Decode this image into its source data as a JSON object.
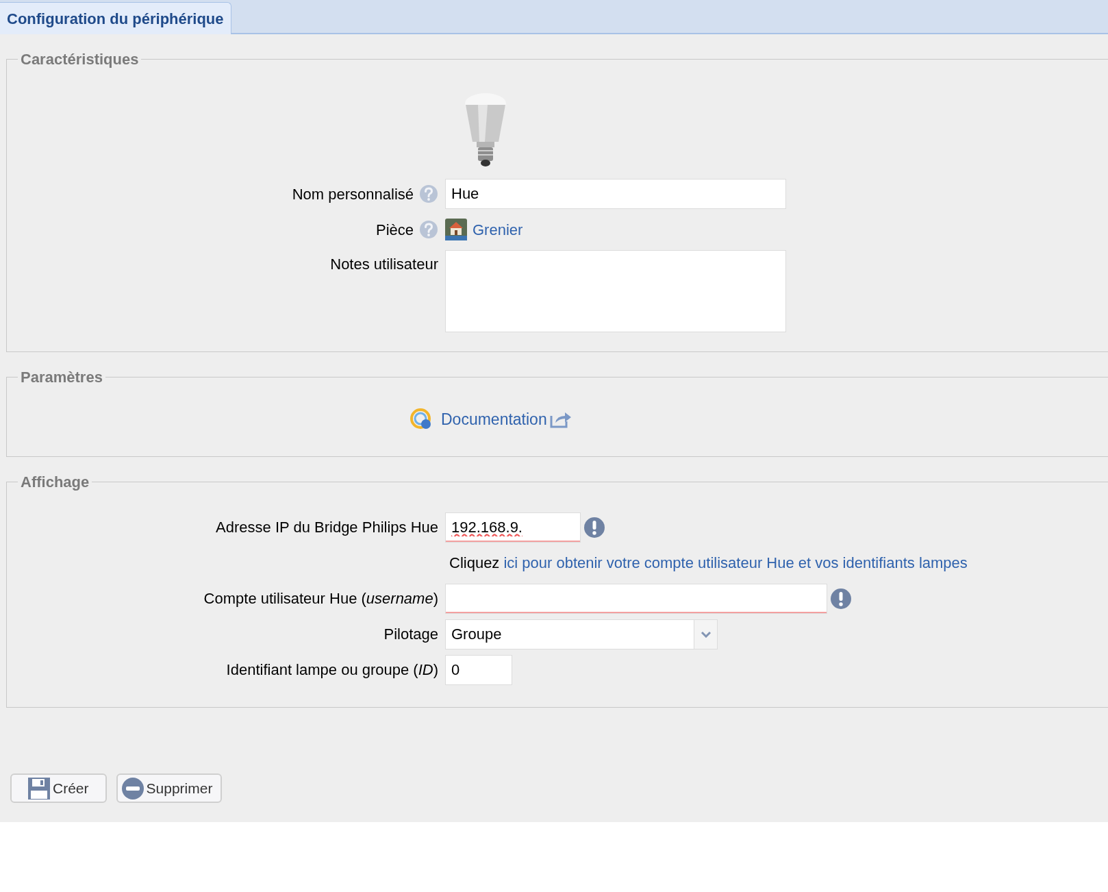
{
  "tab": {
    "label": "Configuration du périphérique",
    "selected": true
  },
  "sections": [
    {
      "legend": "Caractéristiques",
      "kind": "characteristics",
      "fields": [
        {
          "kind": "text",
          "label": "Nom personnalisé",
          "help": true,
          "value": "Hue",
          "warning": false
        },
        {
          "kind": "room",
          "label": "Pièce",
          "help": true,
          "value": "Grenier"
        },
        {
          "kind": "textarea",
          "label": "Notes utilisateur",
          "help": false
        }
      ]
    },
    {
      "legend": "Paramètres",
      "kind": "parameters",
      "link": "Documentation"
    },
    {
      "legend": "Affichage",
      "kind": "display",
      "fields": [
        {
          "kind": "text",
          "label": "Adresse IP du Bridge Philips Hue",
          "help": false,
          "value": "192.168.9.",
          "warning": true
        },
        {
          "kind": "hint",
          "text": "Cliquez",
          "link": "ici pour obtenir votre compte utilisateur Hue et vos identifiants lampes"
        },
        {
          "kind": "text",
          "label": "Compte utilisateur Hue (*username*)",
          "help": false,
          "warning": true
        },
        {
          "kind": "select",
          "label": "Pilotage",
          "help": false,
          "value": "Groupe"
        },
        {
          "kind": "text",
          "label": "Identifiant lampe ou groupe (*ID*)",
          "help": false,
          "value": "0",
          "warning": false
        }
      ]
    }
  ],
  "buttons": [
    {
      "kind": "save",
      "label": "Créer"
    },
    {
      "kind": "delete",
      "label": "Supprimer"
    }
  ]
}
